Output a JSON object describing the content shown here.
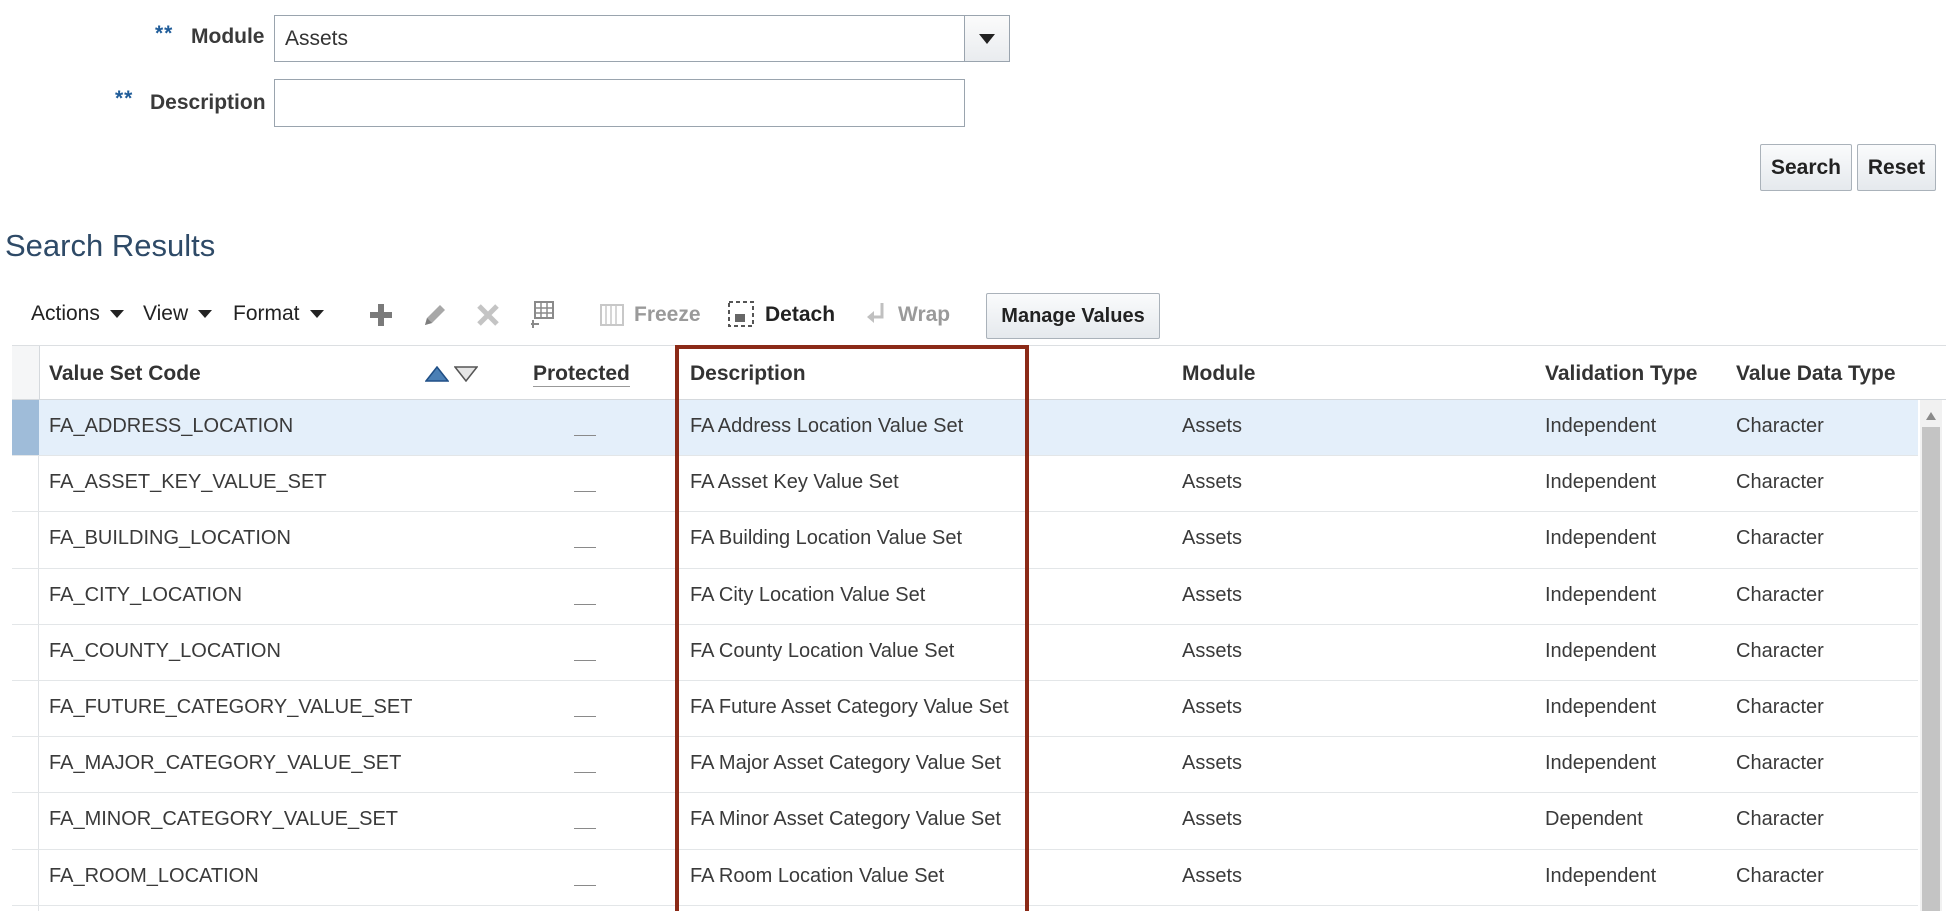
{
  "search_form": {
    "module_required": "**",
    "module_label": "Module",
    "module_value": "Assets",
    "description_required": "**",
    "description_label": "Description",
    "description_value": "",
    "search_label": "Search",
    "reset_label": "Reset"
  },
  "results": {
    "title": "Search Results",
    "toolbar": {
      "actions_label": "Actions",
      "view_label": "View",
      "format_label": "Format",
      "add_icon": "plus-icon",
      "edit_icon": "pencil-icon",
      "delete_icon": "x-icon",
      "columns_icon": "table-columns-icon",
      "freeze_label": "Freeze",
      "detach_label": "Detach",
      "wrap_label": "Wrap",
      "manage_values_label": "Manage Values"
    },
    "columns": {
      "code": "Value Set Code",
      "protected": "Protected",
      "description": "Description",
      "module": "Module",
      "validation_type": "Validation Type",
      "value_data_type": "Value Data Type"
    },
    "rows": [
      {
        "code": "FA_ADDRESS_LOCATION",
        "description": "FA Address Location Value Set",
        "module": "Assets",
        "validation": "Independent",
        "datatype": "Character"
      },
      {
        "code": "FA_ASSET_KEY_VALUE_SET",
        "description": "FA Asset Key Value Set",
        "module": "Assets",
        "validation": "Independent",
        "datatype": "Character"
      },
      {
        "code": "FA_BUILDING_LOCATION",
        "description": "FA Building Location Value Set",
        "module": "Assets",
        "validation": "Independent",
        "datatype": "Character"
      },
      {
        "code": "FA_CITY_LOCATION",
        "description": "FA City Location Value Set",
        "module": "Assets",
        "validation": "Independent",
        "datatype": "Character"
      },
      {
        "code": "FA_COUNTY_LOCATION",
        "description": "FA County Location Value Set",
        "module": "Assets",
        "validation": "Independent",
        "datatype": "Character"
      },
      {
        "code": "FA_FUTURE_CATEGORY_VALUE_SET",
        "description": "FA Future Asset Category Value Set",
        "module": "Assets",
        "validation": "Independent",
        "datatype": "Character"
      },
      {
        "code": "FA_MAJOR_CATEGORY_VALUE_SET",
        "description": "FA Major Asset Category Value Set",
        "module": "Assets",
        "validation": "Independent",
        "datatype": "Character"
      },
      {
        "code": "FA_MINOR_CATEGORY_VALUE_SET",
        "description": "FA Minor Asset Category Value Set",
        "module": "Assets",
        "validation": "Dependent",
        "datatype": "Character"
      },
      {
        "code": "FA_ROOM_LOCATION",
        "description": "FA Room Location Value Set",
        "module": "Assets",
        "validation": "Independent",
        "datatype": "Character"
      }
    ]
  },
  "colors": {
    "selected_row": "#e4effa",
    "highlight_border": "#8b2a17",
    "title_blue": "#2e4a67"
  }
}
